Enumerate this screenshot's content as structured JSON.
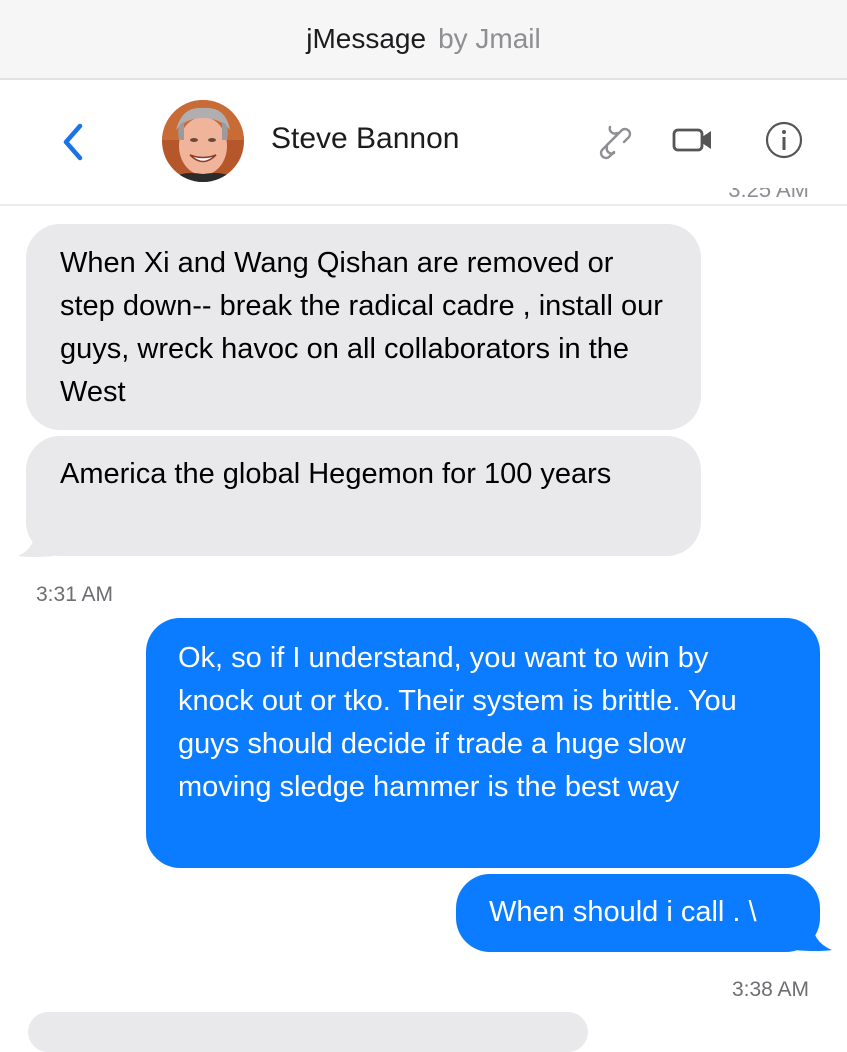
{
  "app_bar": {
    "app_name": "jMessage",
    "by_line": "by Jmail"
  },
  "header": {
    "contact_name": "Steve Bannon",
    "icons": [
      "chevron-left-icon",
      "link-icon",
      "video-camera-icon",
      "info-icon"
    ]
  },
  "colors": {
    "accent": "#0b7cff",
    "incoming_bubble": "#e9e9eb",
    "icon_gray": "#8e8e93",
    "back_blue": "#1a73e8"
  },
  "messages": [
    {
      "direction": "incoming",
      "text": "When Xi and Wang Qishan are removed or step down-- break the radical cadre , install our guys, wreck havoc on all collaborators in the West"
    },
    {
      "direction": "incoming",
      "text": "America the global Hegemon for 100 years"
    },
    {
      "direction": "outgoing",
      "text": "Ok, so if I understand, you want to win by knock out or tko. Their system is brittle. You guys should decide if trade a huge slow moving sledge hammer is the best way"
    },
    {
      "direction": "outgoing",
      "text": "When should i call . \\"
    }
  ],
  "timestamps": {
    "clipped_top": "3:25 AM",
    "first": "3:31 AM",
    "second": "3:38 AM"
  }
}
